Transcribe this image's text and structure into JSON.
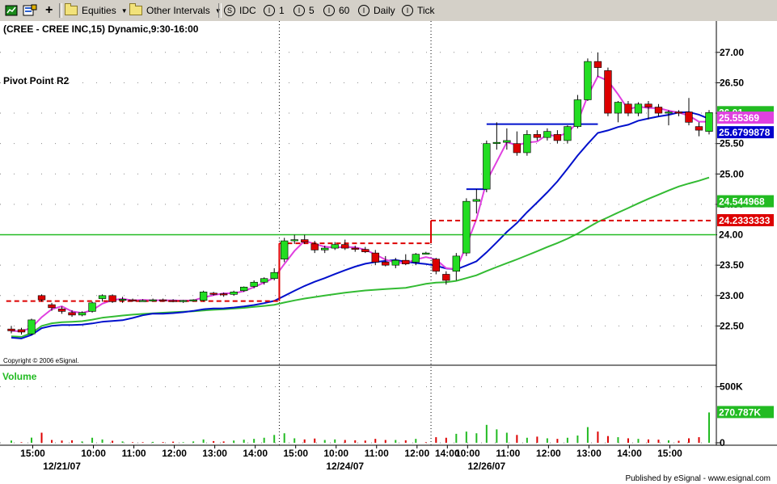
{
  "toolbar": {
    "equities": "Equities",
    "intervals": "Other Intervals",
    "s_btn": "IDC",
    "i1": "1",
    "i5": "5",
    "i60": "60",
    "daily": "Daily",
    "tick": "Tick"
  },
  "chart": {
    "title": "(CREE - CREE INC,15) Dynamic,9:30-16:00",
    "study_label": "Pivot Point R2",
    "copyright": "Copyright © 2006 eSignal.",
    "volume_label": "Volume",
    "published": "Published by eSignal - www.esignal.com"
  },
  "chart_data": {
    "type": "candlestick",
    "symbol": "CREE",
    "interval": "15",
    "price_axis": {
      "ticks": [
        "27.00",
        "26.50",
        "26.00",
        "25.50",
        "25.00",
        "24.50",
        "24.00",
        "23.50",
        "23.00",
        "22.50"
      ],
      "range": [
        22.2,
        27.25
      ]
    },
    "volume_axis": {
      "ticks": [
        "500K",
        "0"
      ],
      "range": [
        0,
        620000
      ]
    },
    "time_labels": [
      "15:00",
      "10:00",
      "11:00",
      "12:00",
      "13:00",
      "14:00",
      "15:00",
      "10:00",
      "11:00",
      "12:00",
      "14:00",
      "10:00",
      "11:00",
      "12:00",
      "13:00",
      "14:00",
      "15:00"
    ],
    "date_labels": [
      "12/21/07",
      "12/24/07",
      "12/26/07"
    ],
    "price_tags": [
      {
        "text": "26.01",
        "value": 26.01,
        "bg": "#22bb22",
        "fg": "#ffffff"
      },
      {
        "text": "25.55369",
        "value": 25.92,
        "bg": "#e040e0",
        "fg": "#ffffff"
      },
      {
        "text": "25.6799878",
        "value": 25.68,
        "bg": "#0000cc",
        "fg": "#ffffff"
      },
      {
        "text": "24.544968",
        "value": 24.545,
        "bg": "#22bb22",
        "fg": "#ffffff"
      },
      {
        "text": "24.2333333",
        "value": 24.233,
        "bg": "#dd0000",
        "fg": "#ffffff"
      },
      {
        "text": "24.00",
        "value": 24.0,
        "bg": "#ffffff",
        "fg": "#000000"
      }
    ],
    "volume_tag": {
      "text": "270.787K",
      "value": 270787
    },
    "horizontal_line": {
      "value": 24.0,
      "color": "#22bb22"
    },
    "candles": [
      {
        "o": 22.45,
        "h": 22.5,
        "l": 22.38,
        "c": 22.42
      },
      {
        "o": 22.44,
        "h": 22.47,
        "l": 22.36,
        "c": 22.4
      },
      {
        "o": 22.37,
        "h": 22.62,
        "l": 22.35,
        "c": 22.6
      },
      {
        "o": 23.0,
        "h": 23.02,
        "l": 22.9,
        "c": 22.93
      },
      {
        "o": 22.85,
        "h": 22.88,
        "l": 22.75,
        "c": 22.8
      },
      {
        "o": 22.78,
        "h": 22.82,
        "l": 22.7,
        "c": 22.74
      },
      {
        "o": 22.72,
        "h": 22.76,
        "l": 22.65,
        "c": 22.68
      },
      {
        "o": 22.68,
        "h": 22.74,
        "l": 22.66,
        "c": 22.72
      },
      {
        "o": 22.74,
        "h": 22.9,
        "l": 22.72,
        "c": 22.88
      },
      {
        "o": 22.95,
        "h": 23.02,
        "l": 22.9,
        "c": 23.0
      },
      {
        "o": 23.0,
        "h": 23.02,
        "l": 22.88,
        "c": 22.9
      },
      {
        "o": 22.92,
        "h": 22.98,
        "l": 22.88,
        "c": 22.94
      },
      {
        "o": 22.93,
        "h": 22.95,
        "l": 22.9,
        "c": 22.92
      },
      {
        "o": 22.92,
        "h": 22.94,
        "l": 22.9,
        "c": 22.92
      },
      {
        "o": 22.92,
        "h": 22.95,
        "l": 22.9,
        "c": 22.93
      },
      {
        "o": 22.93,
        "h": 22.95,
        "l": 22.9,
        "c": 22.92
      },
      {
        "o": 22.92,
        "h": 22.94,
        "l": 22.89,
        "c": 22.91
      },
      {
        "o": 22.91,
        "h": 22.93,
        "l": 22.88,
        "c": 22.92
      },
      {
        "o": 22.92,
        "h": 22.94,
        "l": 22.9,
        "c": 22.93
      },
      {
        "o": 22.92,
        "h": 23.08,
        "l": 22.9,
        "c": 23.06
      },
      {
        "o": 23.04,
        "h": 23.06,
        "l": 23.0,
        "c": 23.03
      },
      {
        "o": 23.03,
        "h": 23.05,
        "l": 22.98,
        "c": 23.02
      },
      {
        "o": 23.02,
        "h": 23.08,
        "l": 23.0,
        "c": 23.06
      },
      {
        "o": 23.08,
        "h": 23.15,
        "l": 23.06,
        "c": 23.14
      },
      {
        "o": 23.15,
        "h": 23.25,
        "l": 23.12,
        "c": 23.22
      },
      {
        "o": 23.22,
        "h": 23.3,
        "l": 23.18,
        "c": 23.28
      },
      {
        "o": 23.28,
        "h": 23.45,
        "l": 23.25,
        "c": 23.38
      },
      {
        "o": 23.6,
        "h": 23.95,
        "l": 23.55,
        "c": 23.9
      },
      {
        "o": 23.9,
        "h": 24.0,
        "l": 23.85,
        "c": 23.92
      },
      {
        "o": 23.92,
        "h": 24.0,
        "l": 23.85,
        "c": 23.88
      },
      {
        "o": 23.85,
        "h": 23.9,
        "l": 23.7,
        "c": 23.75
      },
      {
        "o": 23.75,
        "h": 23.82,
        "l": 23.7,
        "c": 23.78
      },
      {
        "o": 23.78,
        "h": 23.88,
        "l": 23.75,
        "c": 23.84
      },
      {
        "o": 23.84,
        "h": 23.92,
        "l": 23.75,
        "c": 23.78
      },
      {
        "o": 23.78,
        "h": 23.82,
        "l": 23.72,
        "c": 23.76
      },
      {
        "o": 23.76,
        "h": 23.8,
        "l": 23.7,
        "c": 23.72
      },
      {
        "o": 23.7,
        "h": 23.75,
        "l": 23.5,
        "c": 23.55
      },
      {
        "o": 23.55,
        "h": 23.65,
        "l": 23.48,
        "c": 23.5
      },
      {
        "o": 23.5,
        "h": 23.62,
        "l": 23.45,
        "c": 23.58
      },
      {
        "o": 23.58,
        "h": 23.68,
        "l": 23.5,
        "c": 23.52
      },
      {
        "o": 23.55,
        "h": 23.7,
        "l": 23.5,
        "c": 23.68
      },
      {
        "o": 23.7,
        "h": 23.72,
        "l": 23.68,
        "c": 23.7
      },
      {
        "o": 23.6,
        "h": 23.62,
        "l": 23.35,
        "c": 23.4
      },
      {
        "o": 23.35,
        "h": 23.4,
        "l": 23.18,
        "c": 23.25
      },
      {
        "o": 23.4,
        "h": 23.7,
        "l": 23.25,
        "c": 23.65
      },
      {
        "o": 23.7,
        "h": 24.6,
        "l": 23.65,
        "c": 24.55
      },
      {
        "o": 24.55,
        "h": 24.75,
        "l": 24.35,
        "c": 24.58
      },
      {
        "o": 24.75,
        "h": 25.55,
        "l": 24.7,
        "c": 25.5
      },
      {
        "o": 25.5,
        "h": 25.85,
        "l": 25.4,
        "c": 25.52
      },
      {
        "o": 25.52,
        "h": 25.75,
        "l": 25.4,
        "c": 25.55
      },
      {
        "o": 25.5,
        "h": 25.7,
        "l": 25.3,
        "c": 25.35
      },
      {
        "o": 25.35,
        "h": 25.72,
        "l": 25.3,
        "c": 25.65
      },
      {
        "o": 25.65,
        "h": 25.72,
        "l": 25.55,
        "c": 25.6
      },
      {
        "o": 25.6,
        "h": 25.75,
        "l": 25.55,
        "c": 25.7
      },
      {
        "o": 25.65,
        "h": 25.72,
        "l": 25.5,
        "c": 25.55
      },
      {
        "o": 25.55,
        "h": 25.8,
        "l": 25.5,
        "c": 25.78
      },
      {
        "o": 25.78,
        "h": 26.3,
        "l": 25.75,
        "c": 26.22
      },
      {
        "o": 26.22,
        "h": 26.9,
        "l": 26.2,
        "c": 26.85
      },
      {
        "o": 26.85,
        "h": 27.0,
        "l": 26.6,
        "c": 26.75
      },
      {
        "o": 26.7,
        "h": 26.75,
        "l": 25.95,
        "c": 26.0
      },
      {
        "o": 26.0,
        "h": 26.2,
        "l": 25.85,
        "c": 26.18
      },
      {
        "o": 26.15,
        "h": 26.2,
        "l": 25.95,
        "c": 26.0
      },
      {
        "o": 26.0,
        "h": 26.18,
        "l": 25.95,
        "c": 26.15
      },
      {
        "o": 26.15,
        "h": 26.2,
        "l": 25.9,
        "c": 26.1
      },
      {
        "o": 26.1,
        "h": 26.15,
        "l": 25.95,
        "c": 26.0
      },
      {
        "o": 26.0,
        "h": 26.05,
        "l": 25.8,
        "c": 26.02
      },
      {
        "o": 26.02,
        "h": 26.05,
        "l": 25.95,
        "c": 26.01
      },
      {
        "o": 26.02,
        "h": 26.25,
        "l": 25.8,
        "c": 25.85
      },
      {
        "o": 25.78,
        "h": 25.85,
        "l": 25.62,
        "c": 25.72
      },
      {
        "o": 25.7,
        "h": 26.05,
        "l": 25.65,
        "c": 26.01
      }
    ],
    "volume": [
      20000,
      5000,
      46000,
      90000,
      25000,
      20000,
      22000,
      12000,
      45000,
      30000,
      18000,
      12000,
      5000,
      5000,
      8000,
      6000,
      10000,
      5000,
      12000,
      30000,
      15000,
      12000,
      20000,
      28000,
      35000,
      45000,
      70000,
      85000,
      40000,
      30000,
      38000,
      25000,
      30000,
      25000,
      22000,
      20000,
      35000,
      25000,
      25000,
      22000,
      35000,
      5000,
      50000,
      45000,
      80000,
      100000,
      85000,
      160000,
      120000,
      90000,
      70000,
      45000,
      55000,
      40000,
      35000,
      45000,
      65000,
      140000,
      100000,
      60000,
      50000,
      40000,
      35000,
      30000,
      28000,
      22000,
      18000,
      40000,
      50000,
      270787
    ],
    "volume_up": [
      true,
      false,
      true,
      false,
      false,
      false,
      false,
      true,
      true,
      true,
      false,
      true,
      false,
      false,
      true,
      false,
      false,
      true,
      true,
      true,
      false,
      false,
      true,
      true,
      true,
      true,
      true,
      true,
      true,
      false,
      false,
      true,
      true,
      false,
      false,
      false,
      false,
      false,
      true,
      false,
      true,
      false,
      false,
      false,
      true,
      true,
      true,
      true,
      true,
      true,
      false,
      true,
      false,
      true,
      false,
      true,
      true,
      true,
      false,
      false,
      true,
      false,
      true,
      false,
      false,
      true,
      false,
      false,
      false,
      true
    ]
  }
}
